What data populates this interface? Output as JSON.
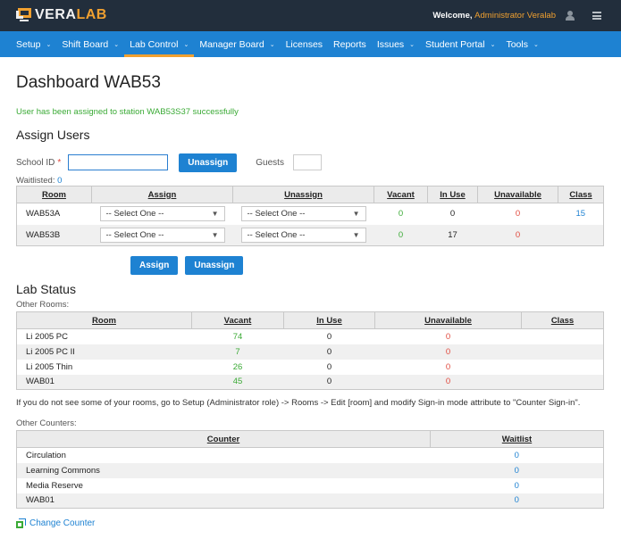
{
  "header": {
    "logo_left": "VERA",
    "logo_right": "LAB",
    "welcome_prefix": "Welcome,",
    "user_name": "Administrator Veralab",
    "icons": [
      "user-icon",
      "menu-icon"
    ]
  },
  "nav": {
    "items": [
      {
        "label": "Setup",
        "dropdown": true
      },
      {
        "label": "Shift Board",
        "dropdown": true
      },
      {
        "label": "Lab Control",
        "dropdown": true,
        "active": true
      },
      {
        "label": "Manager Board",
        "dropdown": true
      },
      {
        "label": "Licenses",
        "dropdown": false
      },
      {
        "label": "Reports",
        "dropdown": false
      },
      {
        "label": "Issues",
        "dropdown": true
      },
      {
        "label": "Student Portal",
        "dropdown": true
      },
      {
        "label": "Tools",
        "dropdown": true
      }
    ]
  },
  "page": {
    "title": "Dashboard WAB53",
    "success_message": "User has been assigned to station WAB53S37 successfully"
  },
  "assign_users": {
    "heading": "Assign Users",
    "school_id_label": "School ID",
    "required_mark": "*",
    "school_id_value": "",
    "unassign_label": "Unassign",
    "guests_label": "Guests",
    "guests_value": "",
    "waitlisted_label": "Waitlisted:",
    "waitlisted_value": "0",
    "table": {
      "headers": [
        "Room",
        "Assign",
        "Unassign",
        "Vacant",
        "In Use",
        "Unavailable",
        "Class"
      ],
      "rows": [
        {
          "room": "WAB53A",
          "assign": "-- Select One --",
          "unassign": "-- Select One --",
          "vacant": "0",
          "in_use": "0",
          "unavailable": "0",
          "class": "15"
        },
        {
          "room": "WAB53B",
          "assign": "-- Select One --",
          "unassign": "-- Select One --",
          "vacant": "0",
          "in_use": "17",
          "unavailable": "0",
          "class": ""
        }
      ]
    },
    "assign_button": "Assign",
    "unassign_button": "Unassign"
  },
  "lab_status": {
    "heading": "Lab Status",
    "other_rooms_label": "Other Rooms:",
    "headers": [
      "Room",
      "Vacant",
      "In Use",
      "Unavailable",
      "Class"
    ],
    "rows": [
      {
        "room": "Li 2005 PC",
        "vacant": "74",
        "in_use": "0",
        "unavailable": "0",
        "class": ""
      },
      {
        "room": "Li 2005 PC II",
        "vacant": "7",
        "in_use": "0",
        "unavailable": "0",
        "class": ""
      },
      {
        "room": "Li 2005 Thin",
        "vacant": "26",
        "in_use": "0",
        "unavailable": "0",
        "class": ""
      },
      {
        "room": "WAB01",
        "vacant": "45",
        "in_use": "0",
        "unavailable": "0",
        "class": ""
      }
    ],
    "note": "If you do not see some of your rooms, go to Setup (Administrator role) -> Rooms -> Edit [room] and modify Sign-in mode attribute to \"Counter Sign-in\".",
    "other_counters_label": "Other Counters:",
    "counter_headers": [
      "Counter",
      "Waitlist"
    ],
    "counters": [
      {
        "name": "Circulation",
        "waitlist": "0"
      },
      {
        "name": "Learning Commons",
        "waitlist": "0"
      },
      {
        "name": "Media Reserve",
        "waitlist": "0"
      },
      {
        "name": "WAB01",
        "waitlist": "0"
      }
    ],
    "change_counter": "Change Counter"
  },
  "colors": {
    "topbar": "#222e3c",
    "nav": "#1e82d2",
    "accent": "#f0a030",
    "green": "#3aaa35",
    "red": "#e0483c",
    "link": "#1e82d2"
  }
}
